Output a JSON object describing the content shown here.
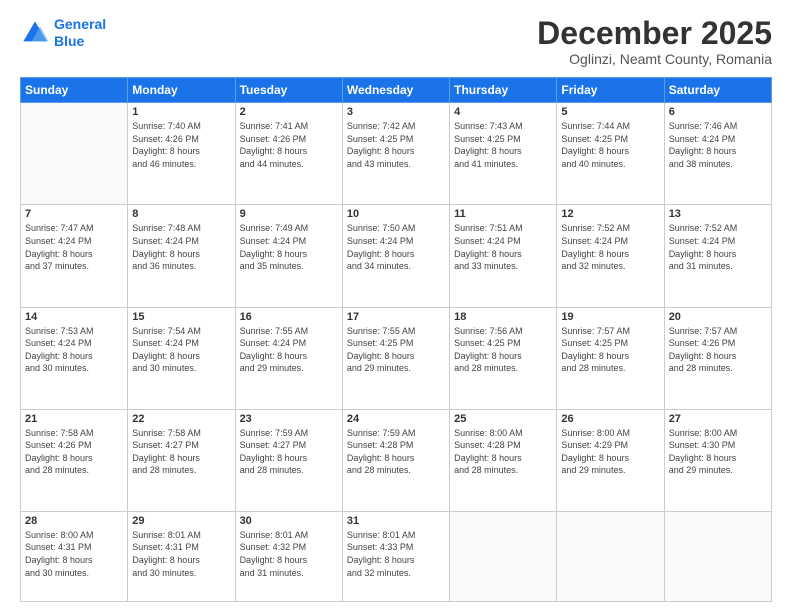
{
  "header": {
    "logo_line1": "General",
    "logo_line2": "Blue",
    "month": "December 2025",
    "location": "Oglinzi, Neamt County, Romania"
  },
  "weekdays": [
    "Sunday",
    "Monday",
    "Tuesday",
    "Wednesday",
    "Thursday",
    "Friday",
    "Saturday"
  ],
  "weeks": [
    [
      {
        "day": "",
        "info": ""
      },
      {
        "day": "1",
        "info": "Sunrise: 7:40 AM\nSunset: 4:26 PM\nDaylight: 8 hours\nand 46 minutes."
      },
      {
        "day": "2",
        "info": "Sunrise: 7:41 AM\nSunset: 4:26 PM\nDaylight: 8 hours\nand 44 minutes."
      },
      {
        "day": "3",
        "info": "Sunrise: 7:42 AM\nSunset: 4:25 PM\nDaylight: 8 hours\nand 43 minutes."
      },
      {
        "day": "4",
        "info": "Sunrise: 7:43 AM\nSunset: 4:25 PM\nDaylight: 8 hours\nand 41 minutes."
      },
      {
        "day": "5",
        "info": "Sunrise: 7:44 AM\nSunset: 4:25 PM\nDaylight: 8 hours\nand 40 minutes."
      },
      {
        "day": "6",
        "info": "Sunrise: 7:46 AM\nSunset: 4:24 PM\nDaylight: 8 hours\nand 38 minutes."
      }
    ],
    [
      {
        "day": "7",
        "info": "Sunrise: 7:47 AM\nSunset: 4:24 PM\nDaylight: 8 hours\nand 37 minutes."
      },
      {
        "day": "8",
        "info": "Sunrise: 7:48 AM\nSunset: 4:24 PM\nDaylight: 8 hours\nand 36 minutes."
      },
      {
        "day": "9",
        "info": "Sunrise: 7:49 AM\nSunset: 4:24 PM\nDaylight: 8 hours\nand 35 minutes."
      },
      {
        "day": "10",
        "info": "Sunrise: 7:50 AM\nSunset: 4:24 PM\nDaylight: 8 hours\nand 34 minutes."
      },
      {
        "day": "11",
        "info": "Sunrise: 7:51 AM\nSunset: 4:24 PM\nDaylight: 8 hours\nand 33 minutes."
      },
      {
        "day": "12",
        "info": "Sunrise: 7:52 AM\nSunset: 4:24 PM\nDaylight: 8 hours\nand 32 minutes."
      },
      {
        "day": "13",
        "info": "Sunrise: 7:52 AM\nSunset: 4:24 PM\nDaylight: 8 hours\nand 31 minutes."
      }
    ],
    [
      {
        "day": "14",
        "info": "Sunrise: 7:53 AM\nSunset: 4:24 PM\nDaylight: 8 hours\nand 30 minutes."
      },
      {
        "day": "15",
        "info": "Sunrise: 7:54 AM\nSunset: 4:24 PM\nDaylight: 8 hours\nand 30 minutes."
      },
      {
        "day": "16",
        "info": "Sunrise: 7:55 AM\nSunset: 4:24 PM\nDaylight: 8 hours\nand 29 minutes."
      },
      {
        "day": "17",
        "info": "Sunrise: 7:55 AM\nSunset: 4:25 PM\nDaylight: 8 hours\nand 29 minutes."
      },
      {
        "day": "18",
        "info": "Sunrise: 7:56 AM\nSunset: 4:25 PM\nDaylight: 8 hours\nand 28 minutes."
      },
      {
        "day": "19",
        "info": "Sunrise: 7:57 AM\nSunset: 4:25 PM\nDaylight: 8 hours\nand 28 minutes."
      },
      {
        "day": "20",
        "info": "Sunrise: 7:57 AM\nSunset: 4:26 PM\nDaylight: 8 hours\nand 28 minutes."
      }
    ],
    [
      {
        "day": "21",
        "info": "Sunrise: 7:58 AM\nSunset: 4:26 PM\nDaylight: 8 hours\nand 28 minutes."
      },
      {
        "day": "22",
        "info": "Sunrise: 7:58 AM\nSunset: 4:27 PM\nDaylight: 8 hours\nand 28 minutes."
      },
      {
        "day": "23",
        "info": "Sunrise: 7:59 AM\nSunset: 4:27 PM\nDaylight: 8 hours\nand 28 minutes."
      },
      {
        "day": "24",
        "info": "Sunrise: 7:59 AM\nSunset: 4:28 PM\nDaylight: 8 hours\nand 28 minutes."
      },
      {
        "day": "25",
        "info": "Sunrise: 8:00 AM\nSunset: 4:28 PM\nDaylight: 8 hours\nand 28 minutes."
      },
      {
        "day": "26",
        "info": "Sunrise: 8:00 AM\nSunset: 4:29 PM\nDaylight: 8 hours\nand 29 minutes."
      },
      {
        "day": "27",
        "info": "Sunrise: 8:00 AM\nSunset: 4:30 PM\nDaylight: 8 hours\nand 29 minutes."
      }
    ],
    [
      {
        "day": "28",
        "info": "Sunrise: 8:00 AM\nSunset: 4:31 PM\nDaylight: 8 hours\nand 30 minutes."
      },
      {
        "day": "29",
        "info": "Sunrise: 8:01 AM\nSunset: 4:31 PM\nDaylight: 8 hours\nand 30 minutes."
      },
      {
        "day": "30",
        "info": "Sunrise: 8:01 AM\nSunset: 4:32 PM\nDaylight: 8 hours\nand 31 minutes."
      },
      {
        "day": "31",
        "info": "Sunrise: 8:01 AM\nSunset: 4:33 PM\nDaylight: 8 hours\nand 32 minutes."
      },
      {
        "day": "",
        "info": ""
      },
      {
        "day": "",
        "info": ""
      },
      {
        "day": "",
        "info": ""
      }
    ]
  ]
}
